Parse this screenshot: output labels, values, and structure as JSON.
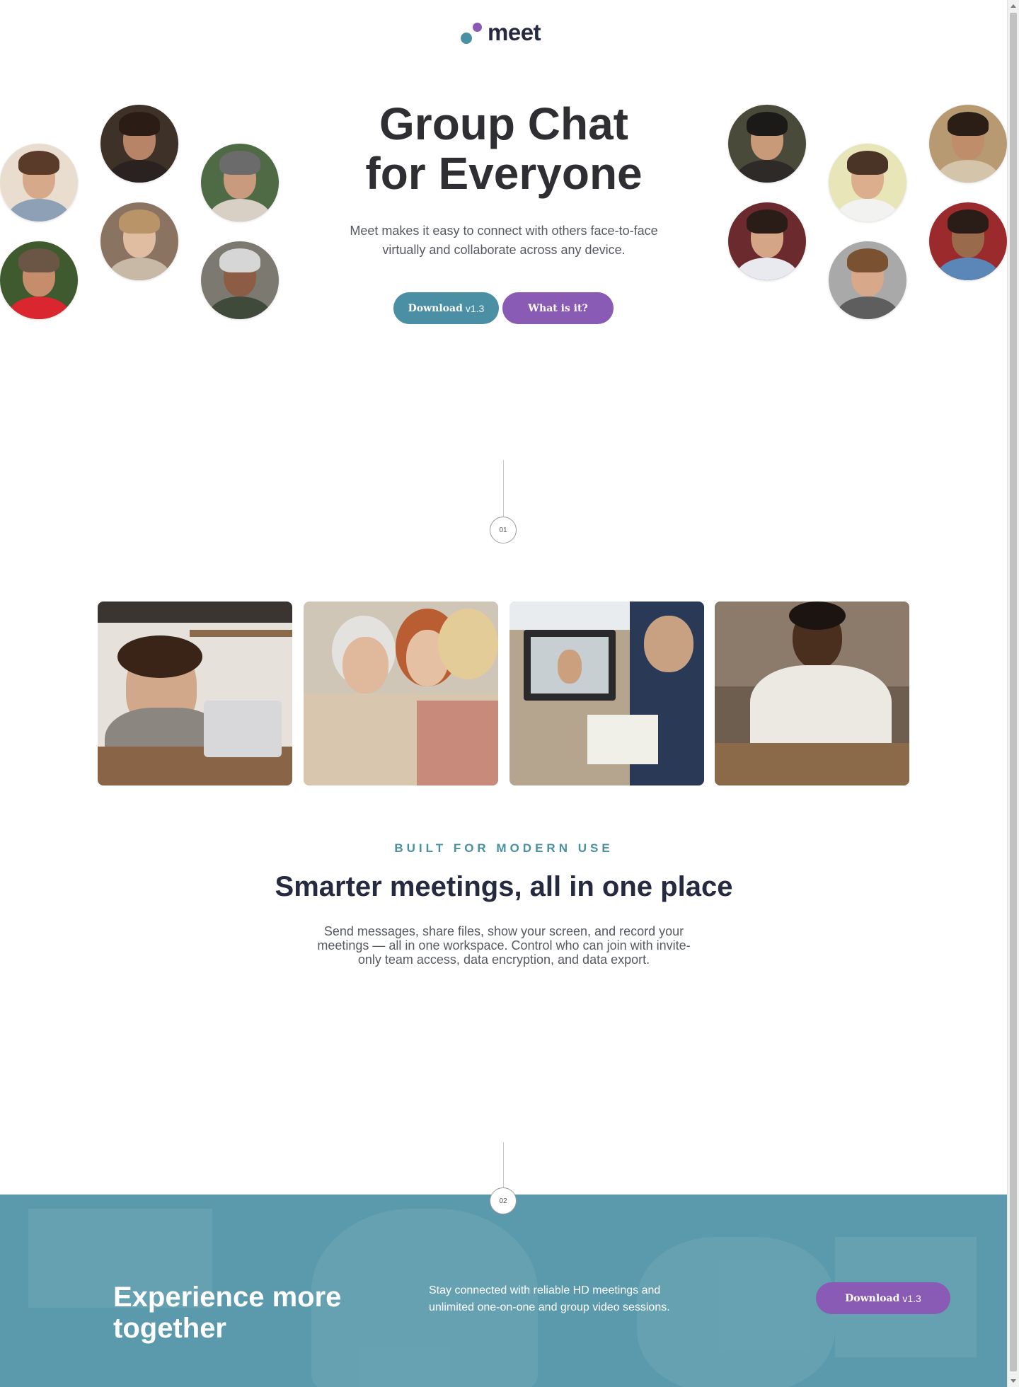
{
  "brand": {
    "name": "meet"
  },
  "hero": {
    "title_line1": "Group Chat",
    "title_line2": "for Everyone",
    "subtitle": "Meet makes it easy to connect with others face-to-face virtually and collaborate across any device.",
    "download_label": "Download",
    "download_version": "v1.3",
    "what_label": "What is it?"
  },
  "markers": {
    "first": "01",
    "second": "02"
  },
  "feature": {
    "eyebrow": "BUILT FOR MODERN USE",
    "title": "Smarter meetings, all in one place",
    "body": "Send messages, share files, show your screen, and record your meetings — all in one workspace. Control who can join with invite-only team access, data encryption, and data export."
  },
  "cta": {
    "title": "Experience more together",
    "body": "Stay connected with reliable HD meetings and unlimited one-on-one and group video sessions.",
    "download_label": "Download",
    "download_version": "v1.3"
  },
  "colors": {
    "teal": "#4a8fa3",
    "purple": "#8a5bb5",
    "heading": "#252a40",
    "cta_band": "#5a9aac"
  },
  "icons": [
    "logo-mark-icon"
  ]
}
